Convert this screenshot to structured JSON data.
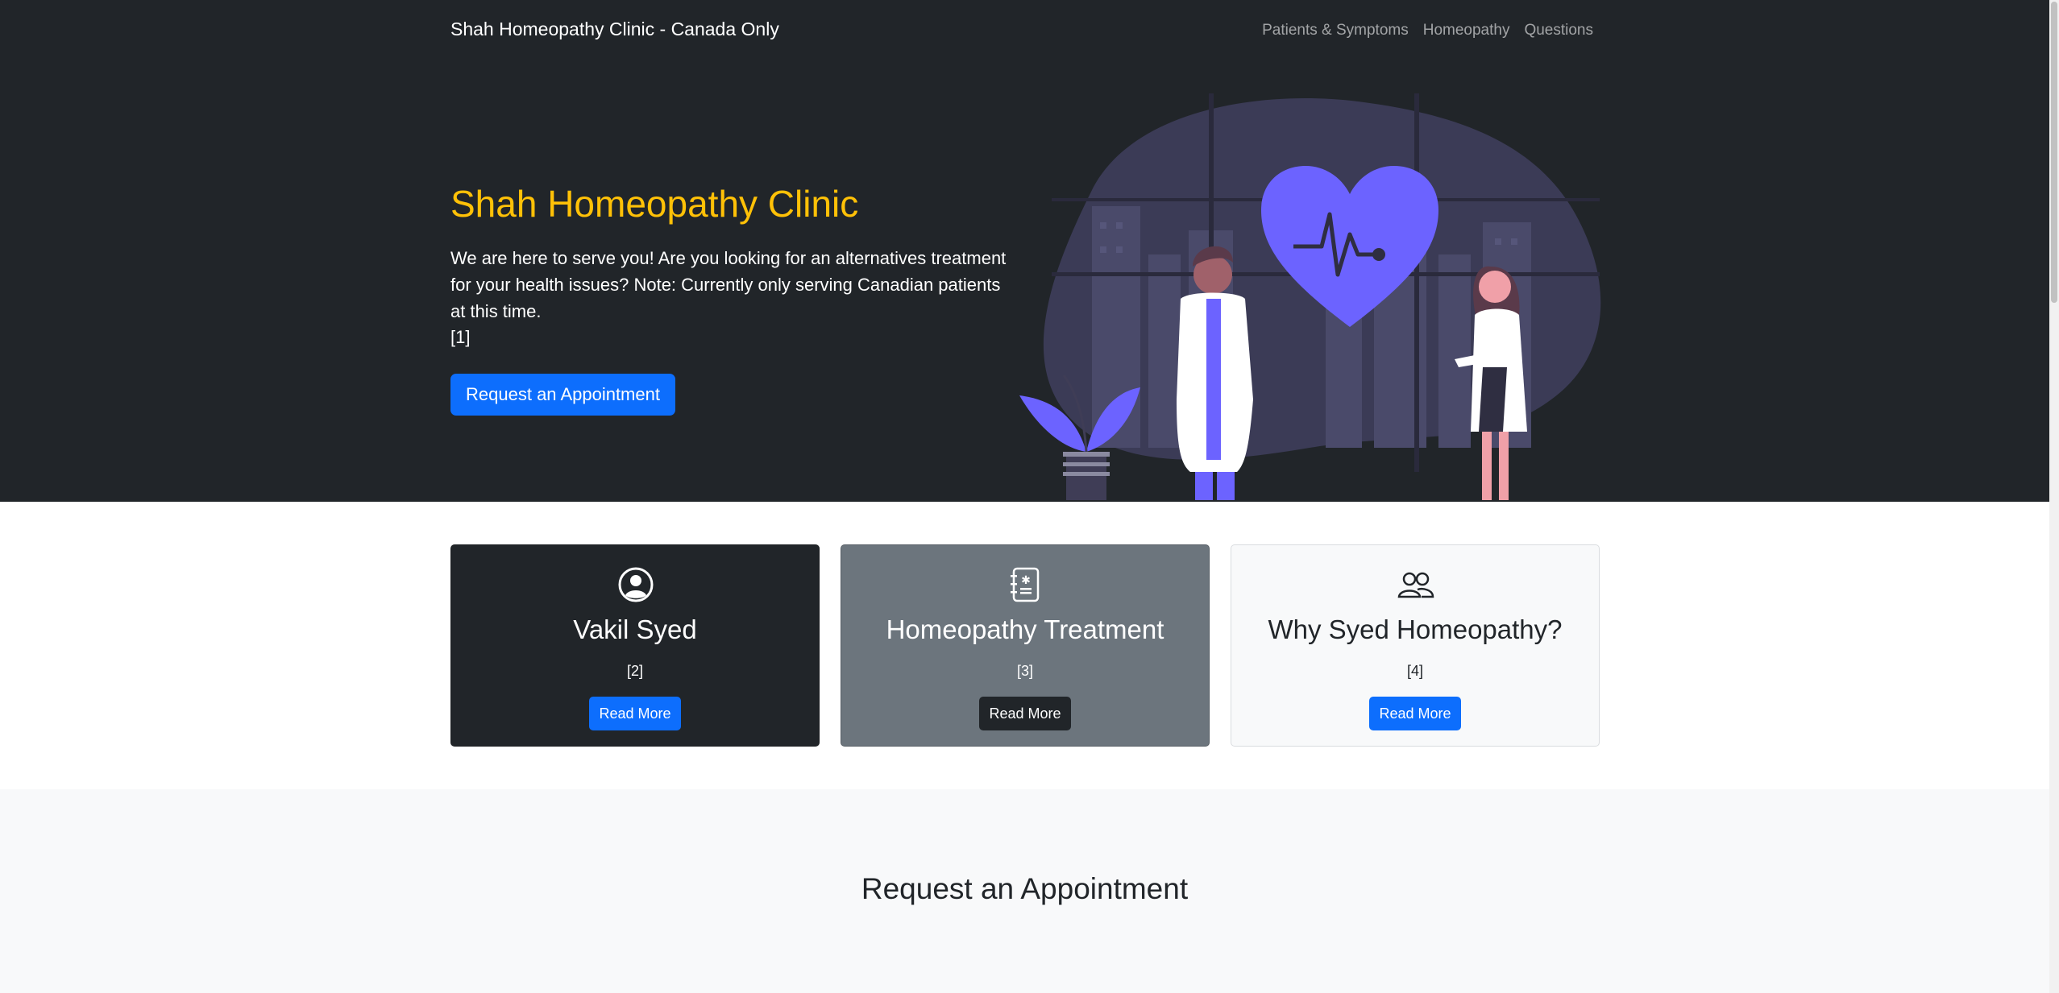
{
  "navbar": {
    "brand": "Shah Homeopathy Clinic - Canada Only",
    "links": [
      "Patients & Symptoms",
      "Homeopathy",
      "Questions"
    ]
  },
  "hero": {
    "title": "Shah Homeopathy Clinic",
    "text": "We are here to serve you! Are you looking for an alternatives treatment for your health issues? Note: Currently only serving Canadian patients at this time.",
    "ref": "[1]",
    "button": "Request an Appointment",
    "illustration_icon": "doctors-heart-illustration"
  },
  "cards": [
    {
      "icon": "person-circle-icon",
      "title": "Vakil Syed",
      "ref": "[2]",
      "button": "Read More"
    },
    {
      "icon": "medical-journal-icon",
      "title": "Homeopathy Treatment",
      "ref": "[3]",
      "button": "Read More"
    },
    {
      "icon": "people-icon",
      "title": "Why Syed Homeopathy?",
      "ref": "[4]",
      "button": "Read More"
    }
  ],
  "appointment": {
    "title": "Request an Appointment"
  },
  "colors": {
    "dark": "#212529",
    "accent": "#ffc107",
    "primary": "#0d6efd",
    "secondary": "#6c757d",
    "light": "#f8f9fa",
    "illustration_purple": "#6c63ff"
  }
}
